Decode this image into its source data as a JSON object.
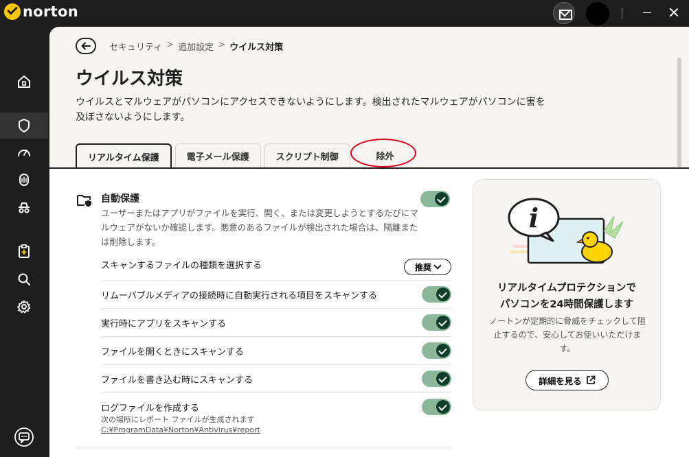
{
  "app": {
    "brand": "norton"
  },
  "breadcrumb": {
    "items": [
      "セキュリティ",
      "追加設定"
    ],
    "separator": ">",
    "current": "ウイルス対策"
  },
  "page": {
    "title": "ウイルス対策",
    "description": "ウイルスとマルウェアがパソコンにアクセスできないようにします。検出されたマルウェアがパソコンに害を及ぼさないようにします。"
  },
  "tabs": [
    "リアルタイム保護",
    "電子メール保護",
    "スクリプト制御",
    "除外"
  ],
  "auto_protect": {
    "title": "自動保護",
    "description": "ユーザーまたはアプリがファイルを実行、開く、または変更しようとするたびにマルウェアがないか確認します。悪意のあるファイルが検出された場合は、隔離または削除します。",
    "enabled": true
  },
  "settings": {
    "scan_file_types": {
      "label": "スキャンするファイルの種類を選択する",
      "value": "推奨"
    },
    "removable_media": {
      "label": "リムーバブルメディアの接続時に自動実行される項目をスキャンする",
      "enabled": true
    },
    "scan_on_run": {
      "label": "実行時にアプリをスキャンする",
      "enabled": true
    },
    "scan_on_open": {
      "label": "ファイルを開くときにスキャンする",
      "enabled": true
    },
    "scan_on_write": {
      "label": "ファイルを書き込む時にスキャンする",
      "enabled": true
    },
    "log_file": {
      "label": "ログファイルを作成する",
      "sub": "次の場所にレポート ファイルが生成されます",
      "path": "C:¥ProgramData¥Norton¥Antivirus¥report",
      "enabled": true
    }
  },
  "info_card": {
    "title_line1": "リアルタイムプロテクションで",
    "title_line2": "パソコンを24時間保護します",
    "text": "ノートンが定期的に脅威をチェックして阻止するので、安心してお使いいただけます。",
    "button": "詳細を見る"
  },
  "colors": {
    "accent": "#ffc700",
    "toggle_track": "#8cb89a",
    "toggle_knob": "#0f3d2a",
    "highlight": "#e0001a"
  }
}
